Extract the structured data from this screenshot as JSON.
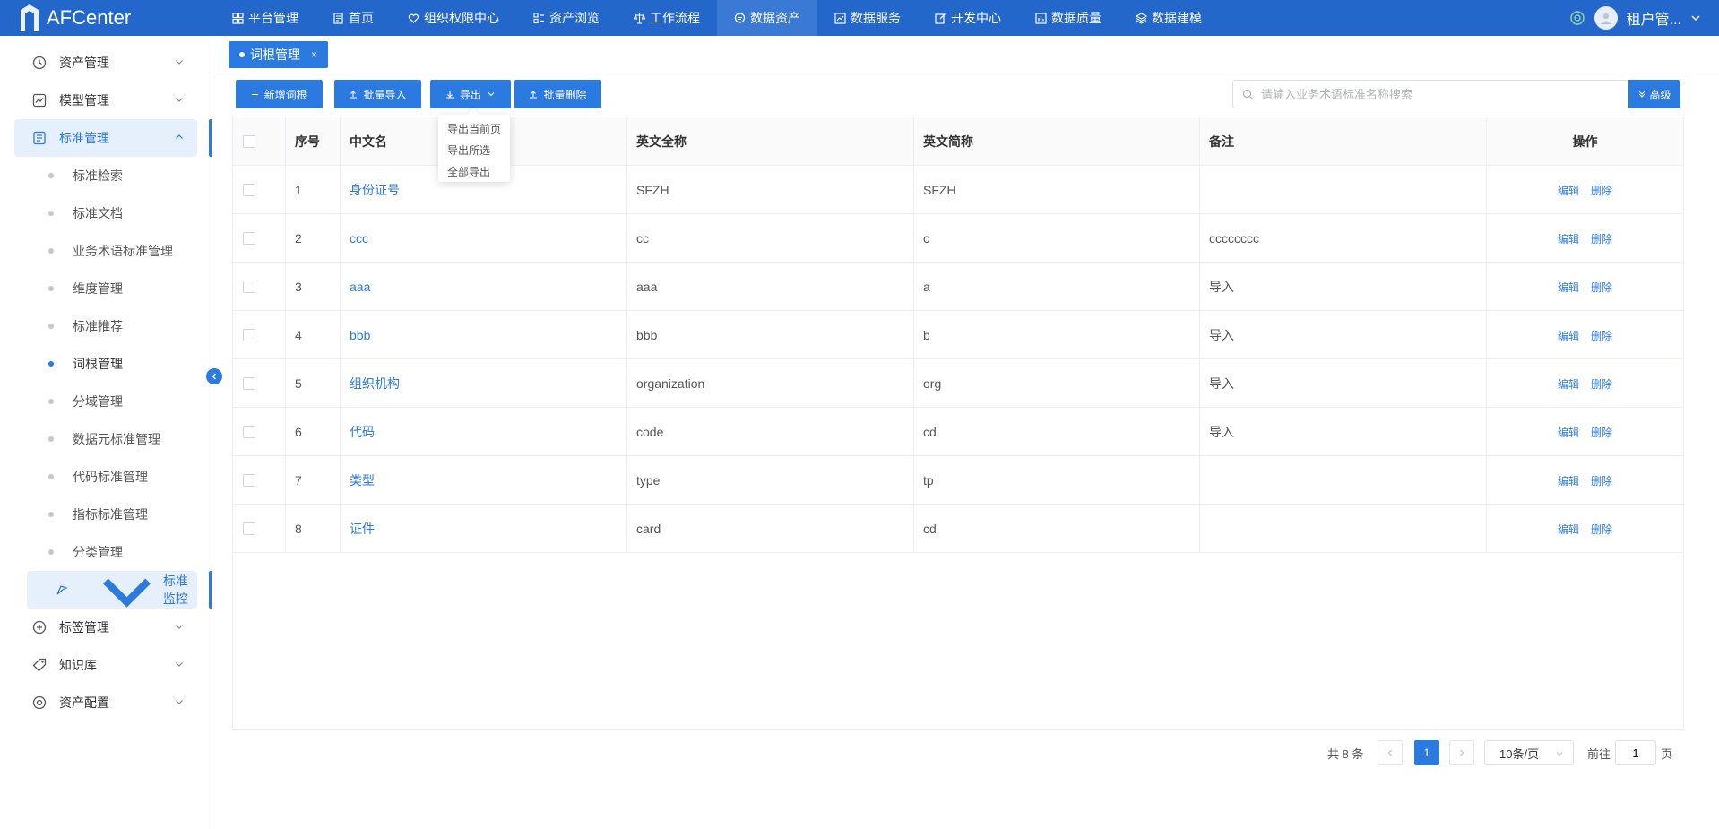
{
  "app": {
    "title": "AFCenter",
    "nav": [
      {
        "label": "平台管理",
        "icon": "grid-icon"
      },
      {
        "label": "首页",
        "icon": "document-icon"
      },
      {
        "label": "组织权限中心",
        "icon": "shield-heart-icon"
      },
      {
        "label": "资产浏览",
        "icon": "list-icon"
      },
      {
        "label": "工作流程",
        "icon": "scale-icon"
      },
      {
        "label": "数据资产",
        "icon": "chat-icon"
      },
      {
        "label": "数据服务",
        "icon": "chart-icon"
      },
      {
        "label": "开发中心",
        "icon": "edit-icon"
      },
      {
        "label": "数据质量",
        "icon": "bar-chart-icon"
      },
      {
        "label": "数据建模",
        "icon": "layers-icon"
      }
    ],
    "active_nav": "数据资产",
    "user": {
      "name": "租户管..."
    }
  },
  "sidebar": {
    "groups_top": [
      {
        "label": "资产管理",
        "icon": "clock-icon"
      },
      {
        "label": "模型管理",
        "icon": "line-chart-icon"
      },
      {
        "label": "标准管理",
        "icon": "doc-list-icon"
      }
    ],
    "sub_items": [
      {
        "label": "标准检索"
      },
      {
        "label": "标准文档"
      },
      {
        "label": "业务术语标准管理"
      },
      {
        "label": "维度管理"
      },
      {
        "label": "标准推荐"
      },
      {
        "label": "词根管理"
      },
      {
        "label": "分域管理"
      },
      {
        "label": "数据元标准管理"
      },
      {
        "label": "代码标准管理"
      },
      {
        "label": "指标标准管理"
      },
      {
        "label": "分类管理"
      },
      {
        "label": "标准监控"
      }
    ],
    "groups_bottom": [
      {
        "label": "标签管理",
        "icon": "plus-circle-icon"
      },
      {
        "label": "知识库",
        "icon": "tag-icon"
      },
      {
        "label": "资产配置",
        "icon": "target-icon"
      }
    ]
  },
  "tabs": [
    {
      "label": "词根管理"
    }
  ],
  "toolbar": {
    "add": "新增词根",
    "batch_import": "批量导入",
    "export": "导出",
    "batch_delete": "批量删除",
    "search_placeholder": "请输入业务术语标准名称搜索",
    "advanced": "高级"
  },
  "export_menu": [
    "导出当前页",
    "导出所选",
    "全部导出"
  ],
  "table": {
    "headers": [
      "序号",
      "中文名",
      "英文全称",
      "英文简称",
      "备注",
      "操作"
    ],
    "rows": [
      {
        "no": "1",
        "cn": "身份证号",
        "en_full": "SFZH",
        "en_short": "SFZH",
        "note": ""
      },
      {
        "no": "2",
        "cn": "ccc",
        "en_full": "cc",
        "en_short": "c",
        "note": "cccccccc"
      },
      {
        "no": "3",
        "cn": "aaa",
        "en_full": "aaa",
        "en_short": "a",
        "note": "导入"
      },
      {
        "no": "4",
        "cn": "bbb",
        "en_full": "bbb",
        "en_short": "b",
        "note": "导入"
      },
      {
        "no": "5",
        "cn": "组织机构",
        "en_full": "organization",
        "en_short": "org",
        "note": "导入"
      },
      {
        "no": "6",
        "cn": "代码",
        "en_full": "code",
        "en_short": "cd",
        "note": "导入"
      },
      {
        "no": "7",
        "cn": "类型",
        "en_full": "type",
        "en_short": "tp",
        "note": ""
      },
      {
        "no": "8",
        "cn": "证件",
        "en_full": "card",
        "en_short": "cd",
        "note": ""
      }
    ],
    "edit_label": "编辑",
    "delete_label": "删除"
  },
  "pagination": {
    "total_text": "共 8 条",
    "current_page": "1",
    "page_size": "10条/页",
    "goto_label": "前往",
    "goto_value": "1",
    "page_unit": "页"
  },
  "colors": {
    "primary": "#2b7ae0",
    "topbar": "#2267c9"
  }
}
